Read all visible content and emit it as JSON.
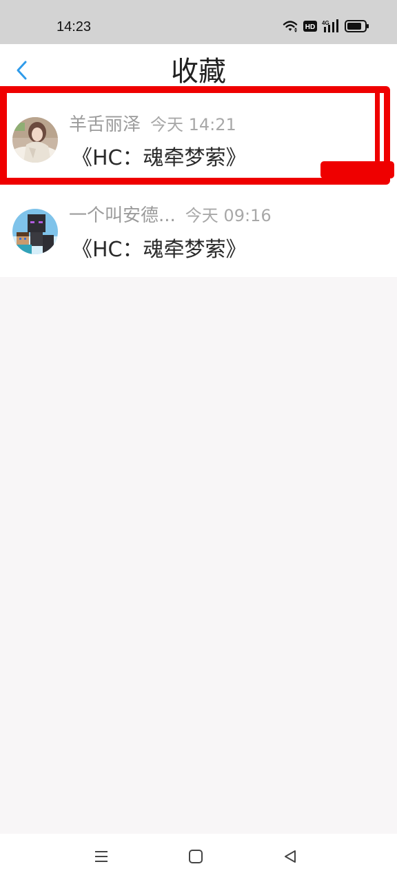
{
  "status_bar": {
    "time": "14:23",
    "icons": [
      "wifi-icon",
      "hd-icon",
      "signal-4g-icon",
      "battery-icon"
    ],
    "hd_label": "HD",
    "network_label": "4G"
  },
  "header": {
    "title": "收藏",
    "back_icon": "chevron-left-icon"
  },
  "favorites": [
    {
      "name": "羊舌丽泽",
      "time": "今天 14:21",
      "title": "《HC：魂牵梦萦》",
      "avatar": "avatar-photo-girl"
    },
    {
      "name": "一个叫安德...",
      "time": "今天 09:16",
      "title": "《HC：魂牵梦萦》",
      "avatar": "avatar-enderman"
    }
  ],
  "nav_bar": {
    "icons": [
      "menu-icon",
      "home-icon",
      "back-triangle-icon"
    ]
  },
  "colors": {
    "accent": "#2f9bea",
    "highlight": "#ef0000",
    "status_bar_bg": "#d3d3d3",
    "page_bg": "#f8f6f7"
  }
}
